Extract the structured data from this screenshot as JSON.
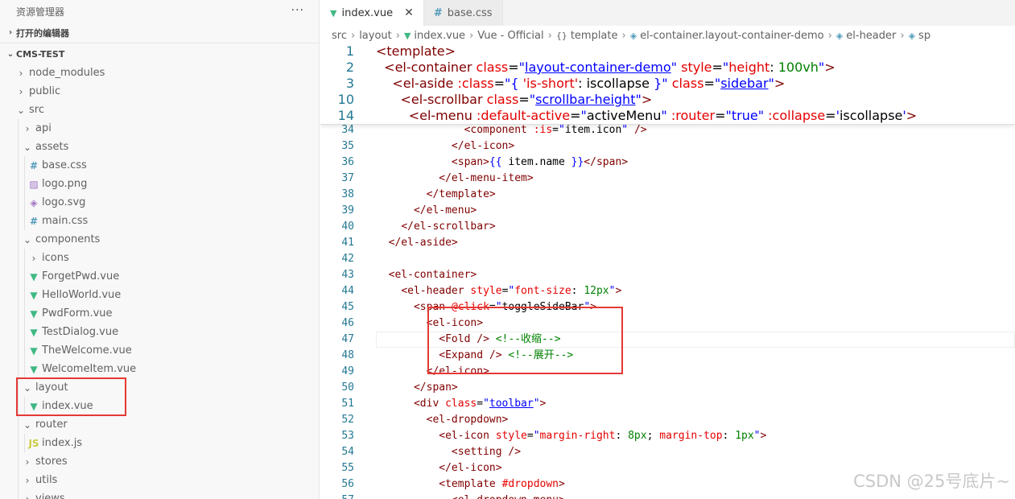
{
  "explorer": {
    "title": "资源管理器",
    "more": "···",
    "open_editors": "打开的编辑器",
    "project": "CMS-TEST",
    "tree": [
      {
        "label": "node_modules",
        "type": "folder",
        "depth": 1,
        "expanded": false
      },
      {
        "label": "public",
        "type": "folder",
        "depth": 1,
        "expanded": false
      },
      {
        "label": "src",
        "type": "folder",
        "depth": 1,
        "expanded": true
      },
      {
        "label": "api",
        "type": "folder",
        "depth": 2,
        "expanded": false
      },
      {
        "label": "assets",
        "type": "folder",
        "depth": 2,
        "expanded": true
      },
      {
        "label": "base.css",
        "type": "css",
        "depth": 3
      },
      {
        "label": "logo.png",
        "type": "png",
        "depth": 3
      },
      {
        "label": "logo.svg",
        "type": "svg",
        "depth": 3
      },
      {
        "label": "main.css",
        "type": "css",
        "depth": 3
      },
      {
        "label": "components",
        "type": "folder",
        "depth": 2,
        "expanded": true
      },
      {
        "label": "icons",
        "type": "folder",
        "depth": 3,
        "expanded": false
      },
      {
        "label": "ForgetPwd.vue",
        "type": "vue",
        "depth": 3
      },
      {
        "label": "HelloWorld.vue",
        "type": "vue",
        "depth": 3
      },
      {
        "label": "PwdForm.vue",
        "type": "vue",
        "depth": 3
      },
      {
        "label": "TestDialog.vue",
        "type": "vue",
        "depth": 3
      },
      {
        "label": "TheWelcome.vue",
        "type": "vue",
        "depth": 3
      },
      {
        "label": "WelcomeItem.vue",
        "type": "vue",
        "depth": 3
      },
      {
        "label": "layout",
        "type": "folder",
        "depth": 2,
        "expanded": true
      },
      {
        "label": "index.vue",
        "type": "vue",
        "depth": 3
      },
      {
        "label": "router",
        "type": "folder",
        "depth": 2,
        "expanded": true
      },
      {
        "label": "index.js",
        "type": "js",
        "depth": 3
      },
      {
        "label": "stores",
        "type": "folder",
        "depth": 2,
        "expanded": false
      },
      {
        "label": "utils",
        "type": "folder",
        "depth": 2,
        "expanded": false
      },
      {
        "label": "views",
        "type": "folder",
        "depth": 2,
        "expanded": false
      }
    ]
  },
  "tabs": [
    {
      "label": "index.vue",
      "icon": "vue-icon",
      "active": true,
      "close": "✕"
    },
    {
      "label": "base.css",
      "icon": "css-icon",
      "active": false
    }
  ],
  "breadcrumbs": [
    "src",
    "layout",
    "index.vue",
    "Vue - Official",
    "template",
    "el-container.layout-container-demo",
    "el-header",
    "sp"
  ],
  "colors": {
    "tag": "#800000",
    "attr": "#e50000",
    "string": "#0000ff",
    "comment": "#008000",
    "line_number": "#237893",
    "vue": "#41b883",
    "highlight_box": "#e53935"
  },
  "sticky_lines": [
    {
      "num": "1",
      "html": "<span class=\"tg\">&lt;template&gt;</span>"
    },
    {
      "num": "2",
      "html": "  <span class=\"tg\">&lt;el-container</span> <span class=\"at\">class</span>=<span class=\"st\">\"<span class=\"lk\">layout-container-demo</span>\"</span> <span class=\"at\">style</span>=<span class=\"st\">\"</span><span class=\"at\">height</span>: <span class=\"cm\">100vh</span><span class=\"st\">\"</span><span class=\"tg\">&gt;</span>"
    },
    {
      "num": "3",
      "html": "    <span class=\"tg\">&lt;el-aside</span> <span class=\"at\">:class</span>=<span class=\"st\">\"{ </span><span class=\"at\">'is-short'</span>: iscollapse <span class=\"st\">}\"</span> <span class=\"at\">class</span>=<span class=\"st\">\"<span class=\"lk\">sidebar</span>\"</span><span class=\"tg\">&gt;</span>"
    },
    {
      "num": "10",
      "html": "      <span class=\"tg\">&lt;el-scrollbar</span> <span class=\"at\">class</span>=<span class=\"st\">\"<span class=\"lk\">scrollbar-height</span>\"</span><span class=\"tg\">&gt;</span>"
    },
    {
      "num": "14",
      "html": "        <span class=\"tg\">&lt;el-menu</span> <span class=\"at\">:default-active</span>=<span class=\"st\">\"</span>activeMenu<span class=\"st\">\"</span> <span class=\"at\">:router</span>=<span class=\"st\">\"</span><span class=\"st\">true</span><span class=\"st\">\"</span> <span class=\"at\">:collapse</span>=<span class=\"st\">'</span>iscollapse<span class=\"st\">'</span><span class=\"tg\">&gt;</span>"
    }
  ],
  "code_lines": [
    {
      "num": "34",
      "html": "              <span class=\"tg\">&lt;component</span> <span class=\"at\">:is</span>=<span class=\"st\">\"</span>item.icon<span class=\"st\">\"</span> <span class=\"tg\">/&gt;</span>"
    },
    {
      "num": "35",
      "html": "            <span class=\"tg\">&lt;/el-icon&gt;</span>"
    },
    {
      "num": "36",
      "html": "            <span class=\"tg\">&lt;span&gt;</span><span class=\"st\">{{</span> item.name <span class=\"st\">}}</span><span class=\"tg\">&lt;/span&gt;</span>"
    },
    {
      "num": "37",
      "html": "          <span class=\"tg\">&lt;/el-menu-item&gt;</span>"
    },
    {
      "num": "38",
      "html": "        <span class=\"tg\">&lt;/template&gt;</span>"
    },
    {
      "num": "39",
      "html": "      <span class=\"tg\">&lt;/el-menu&gt;</span>"
    },
    {
      "num": "40",
      "html": "    <span class=\"tg\">&lt;/el-scrollbar&gt;</span>"
    },
    {
      "num": "41",
      "html": "  <span class=\"tg\">&lt;/el-aside&gt;</span>"
    },
    {
      "num": "42",
      "html": ""
    },
    {
      "num": "43",
      "html": "  <span class=\"tg\">&lt;el-container&gt;</span>"
    },
    {
      "num": "44",
      "html": "    <span class=\"tg\">&lt;el-header</span> <span class=\"at\">style</span>=<span class=\"st\">\"</span><span class=\"at\">font-size</span>: <span class=\"cm\">12px</span><span class=\"st\">\"</span><span class=\"tg\">&gt;</span>"
    },
    {
      "num": "45",
      "html": "      <span class=\"tg\">&lt;span</span> <span class=\"at\">@click</span>=<span class=\"st\">\"</span>toggleSideBar<span class=\"st\">\"</span><span class=\"tg\">&gt;</span>"
    },
    {
      "num": "46",
      "html": "        <span class=\"tg\">&lt;el-icon&gt;</span>"
    },
    {
      "num": "47",
      "html": "          <span class=\"tg\">&lt;Fold /&gt;</span> <span class=\"cm\">&lt;!--收缩--&gt;</span>"
    },
    {
      "num": "48",
      "html": "          <span class=\"tg\">&lt;Expand /&gt;</span> <span class=\"cm\">&lt;!--展开--&gt;</span>"
    },
    {
      "num": "49",
      "html": "        <span class=\"tg\">&lt;/el-icon&gt;</span>"
    },
    {
      "num": "50",
      "html": "      <span class=\"tg\">&lt;/span&gt;</span>"
    },
    {
      "num": "51",
      "html": "      <span class=\"tg\">&lt;div</span> <span class=\"at\">class</span>=<span class=\"st\">\"<span class=\"lk\">toolbar</span>\"</span><span class=\"tg\">&gt;</span>"
    },
    {
      "num": "52",
      "html": "        <span class=\"tg\">&lt;el-dropdown&gt;</span>"
    },
    {
      "num": "53",
      "html": "          <span class=\"tg\">&lt;el-icon</span> <span class=\"at\">style</span>=<span class=\"st\">\"</span><span class=\"at\">margin-right</span>: <span class=\"cm\">8px</span>; <span class=\"at\">margin-top</span>: <span class=\"cm\">1px</span><span class=\"st\">\"</span><span class=\"tg\">&gt;</span>"
    },
    {
      "num": "54",
      "html": "            <span class=\"tg\">&lt;setting /&gt;</span>"
    },
    {
      "num": "55",
      "html": "          <span class=\"tg\">&lt;/el-icon&gt;</span>"
    },
    {
      "num": "56",
      "html": "          <span class=\"tg\">&lt;template</span> <span class=\"at\">#dropdown</span><span class=\"tg\">&gt;</span>"
    },
    {
      "num": "57",
      "html": "            <span class=\"tg\">&lt;el-dropdown-menu&gt;</span>"
    }
  ],
  "watermark": "CSDN @25号底片~"
}
